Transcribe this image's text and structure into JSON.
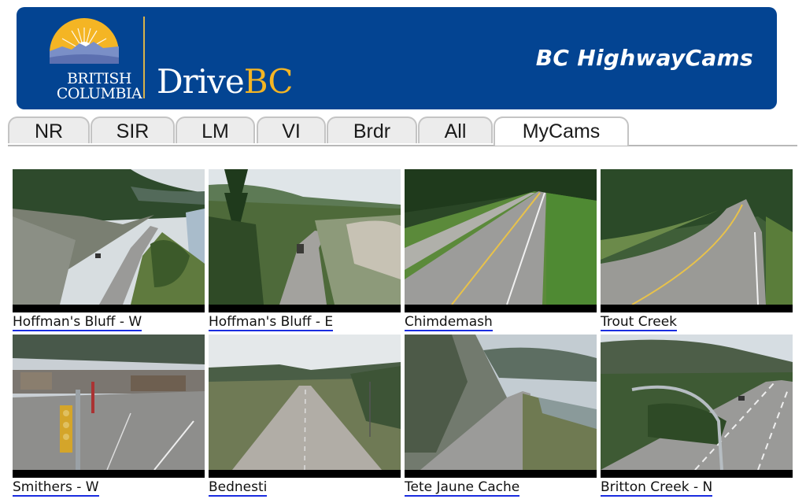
{
  "header": {
    "logo_line1": "BRITISH",
    "logo_line2": "COLUMBIA",
    "brand_drive": "Drive",
    "brand_bc": "BC",
    "site_title": "BC HighwayCams",
    "colors": {
      "banner": "#034492",
      "gold": "#f4b524"
    }
  },
  "tabs": [
    {
      "label": "NR",
      "active": false
    },
    {
      "label": "SIR",
      "active": false
    },
    {
      "label": "LM",
      "active": false
    },
    {
      "label": "VI",
      "active": false
    },
    {
      "label": "Brdr",
      "active": false
    },
    {
      "label": "All",
      "active": false
    },
    {
      "label": "MyCams",
      "active": true
    }
  ],
  "cameras": [
    {
      "name": "Hoffman's Bluff - W",
      "scene": "highway-river-bluff"
    },
    {
      "name": "Hoffman's Bluff - E",
      "scene": "highway-forest-curve"
    },
    {
      "name": "Chimdemash",
      "scene": "highway-straight-meadow"
    },
    {
      "name": "Trout Creek",
      "scene": "highway-curve-trees"
    },
    {
      "name": "Smithers - W",
      "scene": "town-intersection-traffic-light"
    },
    {
      "name": "Bednesti",
      "scene": "highway-straight-hills"
    },
    {
      "name": "Tete Jaune Cache",
      "scene": "highway-rock-cut-clouds"
    },
    {
      "name": "Britton Creek - N",
      "scene": "divided-highway-streetlight"
    }
  ]
}
